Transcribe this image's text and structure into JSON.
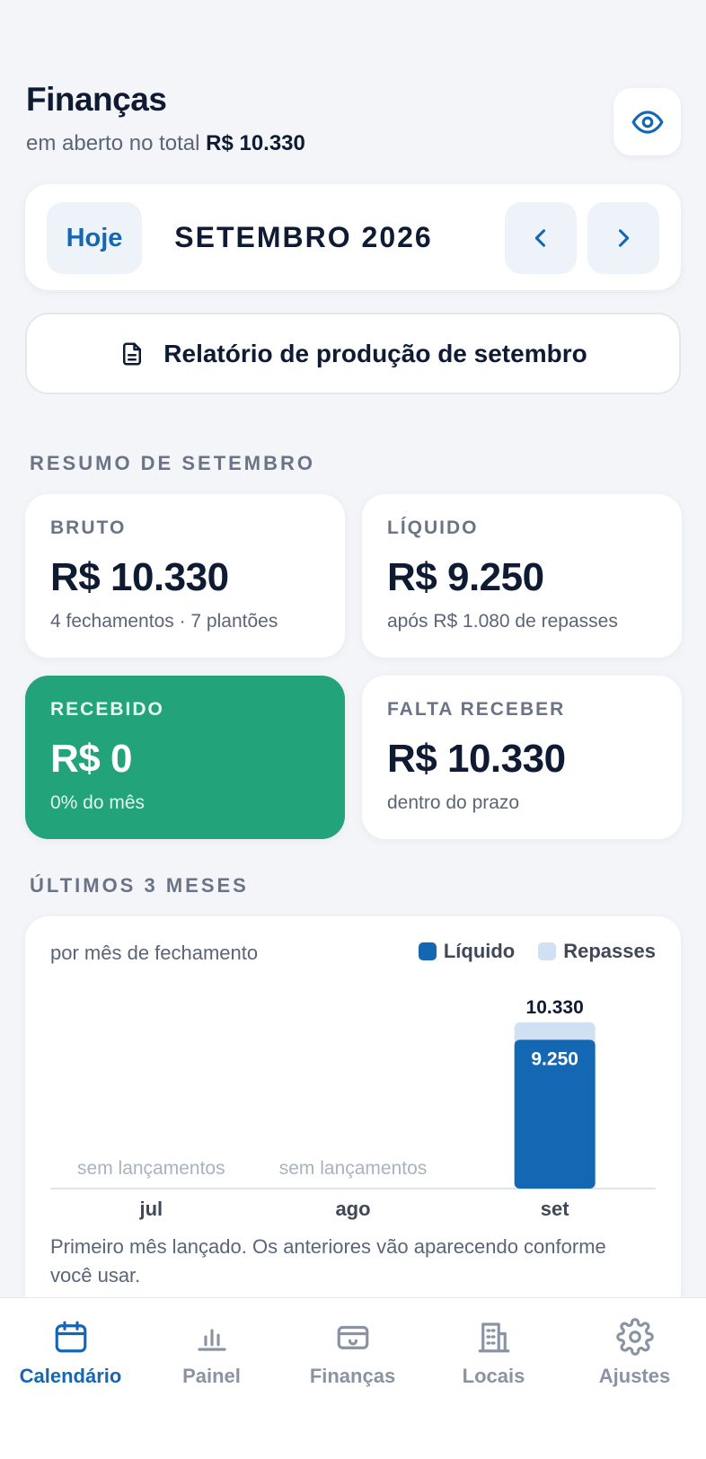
{
  "header": {
    "title": "Finanças",
    "subtitle_prefix": "em aberto no total",
    "subtitle_total": "R$ 10.330"
  },
  "month_nav": {
    "today_label": "Hoje",
    "month": "SETEMBRO 2026"
  },
  "report_button": "Relatório de produção de setembro",
  "summary": {
    "title": "RESUMO DE SETEMBRO",
    "cards": [
      {
        "label": "BRUTO",
        "value": "R$ 10.330",
        "sub": "4 fechamentos · 7 plantões"
      },
      {
        "label": "LÍQUIDO",
        "value": "R$ 9.250",
        "sub": "após R$ 1.080 de repasses"
      },
      {
        "label": "RECEBIDO",
        "value": "R$ 0",
        "sub": "0% do mês"
      },
      {
        "label": "FALTA RECEBER",
        "value": "R$ 10.330",
        "sub": "dentro do prazo"
      }
    ]
  },
  "history": {
    "title": "ÚLTIMOS 3 MESES",
    "caption": "por mês de fechamento",
    "note": "Primeiro mês lançado. Os anteriores vão aparecendo conforme você usar.",
    "empty_label": "sem lançamentos"
  },
  "chart_data": {
    "type": "bar",
    "stacked": true,
    "categories": [
      "jul",
      "ago",
      "set"
    ],
    "series": [
      {
        "name": "Líquido",
        "values": [
          0,
          0,
          9250
        ],
        "color": "#1467b3"
      },
      {
        "name": "Repasses",
        "values": [
          0,
          0,
          1080
        ],
        "color": "#cfe1f2"
      }
    ],
    "totals": [
      0,
      0,
      10330
    ],
    "total_labels": [
      "",
      "",
      "10.330"
    ],
    "value_labels": [
      "",
      "",
      "9.250"
    ],
    "legend_placement": "top-right"
  },
  "tabs": [
    {
      "label": "Calendário",
      "icon": "calendar-icon",
      "active": true
    },
    {
      "label": "Painel",
      "icon": "bar-chart-icon",
      "active": false
    },
    {
      "label": "Finanças",
      "icon": "wallet-icon",
      "active": false
    },
    {
      "label": "Locais",
      "icon": "building-icon",
      "active": false
    },
    {
      "label": "Ajustes",
      "icon": "gear-icon",
      "active": false
    }
  ],
  "colors": {
    "accent": "#1467b3",
    "received_card": "#22a37a",
    "background": "#f3f5f9"
  }
}
